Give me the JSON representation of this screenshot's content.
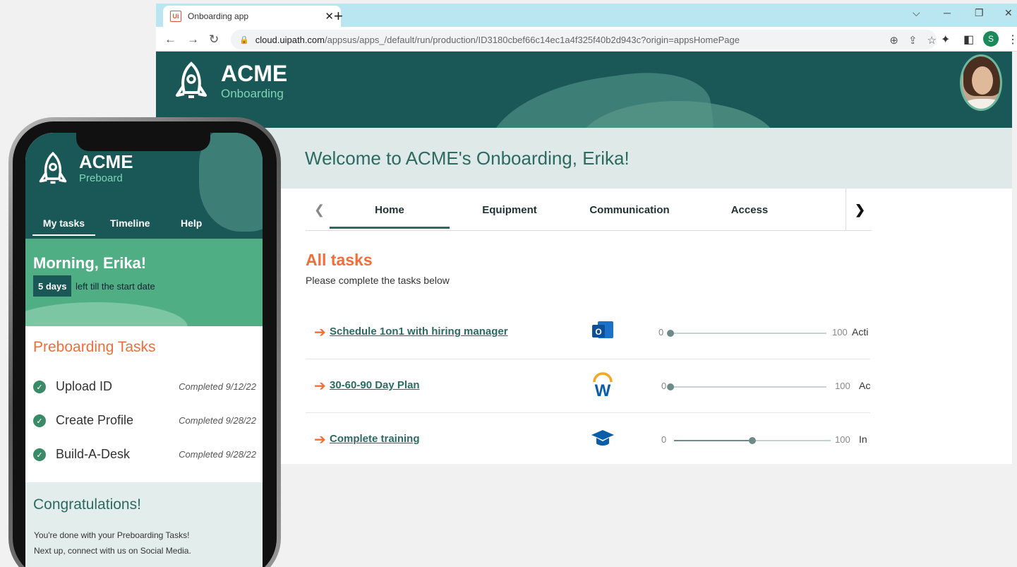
{
  "browser": {
    "tab_title": "Onboarding app",
    "tab_favicon": "Ui",
    "new_tab": "+",
    "url_host": "cloud.uipath.com",
    "url_path": "/appsus/apps_/default/run/production/ID3180cbef66c14ec1a4f325f40b2d943c?origin=appsHomePage",
    "profile_initial": "S"
  },
  "app": {
    "brand_name": "ACME",
    "brand_sub": "Onboarding",
    "welcome": "Welcome to ACME's Onboarding, Erika!",
    "tabs": [
      {
        "label": "Home"
      },
      {
        "label": "Equipment"
      },
      {
        "label": "Communication"
      },
      {
        "label": "Access"
      }
    ],
    "all_tasks_title": "All tasks",
    "all_tasks_subtitle": "Please complete the tasks below",
    "tasks": [
      {
        "label": "Schedule 1on1 with hiring manager",
        "icon": "outlook-icon",
        "min": "0",
        "max": "100",
        "progress": 0,
        "status": "Acti"
      },
      {
        "label": "30-60-90 Day Plan",
        "icon": "workday-icon",
        "min": "0",
        "max": "100",
        "progress": 0,
        "status": "Ac"
      },
      {
        "label": "Complete training",
        "icon": "graduation-cap-icon",
        "min": "0",
        "max": "100",
        "progress": 50,
        "status": "In"
      }
    ]
  },
  "phone": {
    "brand_name": "ACME",
    "brand_sub": "Preboard",
    "tabs": [
      {
        "label": "My tasks"
      },
      {
        "label": "Timeline"
      },
      {
        "label": "Help"
      }
    ],
    "greeting": "Morning, Erika!",
    "days_badge": "5 days",
    "days_text": "left till the start date",
    "tasks_title": "Preboarding Tasks",
    "tasks": [
      {
        "label": "Upload ID",
        "date": "Completed 9/12/22"
      },
      {
        "label": "Create Profile",
        "date": "Completed 9/28/22"
      },
      {
        "label": "Build-A-Desk",
        "date": "Completed 9/28/22"
      }
    ],
    "congrats_title": "Congratulations!",
    "congrats_line1": "You're done with your Preboarding Tasks!",
    "congrats_line2": "Next up, connect with us on Social Media."
  },
  "colors": {
    "brand_dark": "#1a5757",
    "accent_orange": "#f26d3a",
    "mint": "#7fd3b5",
    "green": "#4fae83"
  }
}
